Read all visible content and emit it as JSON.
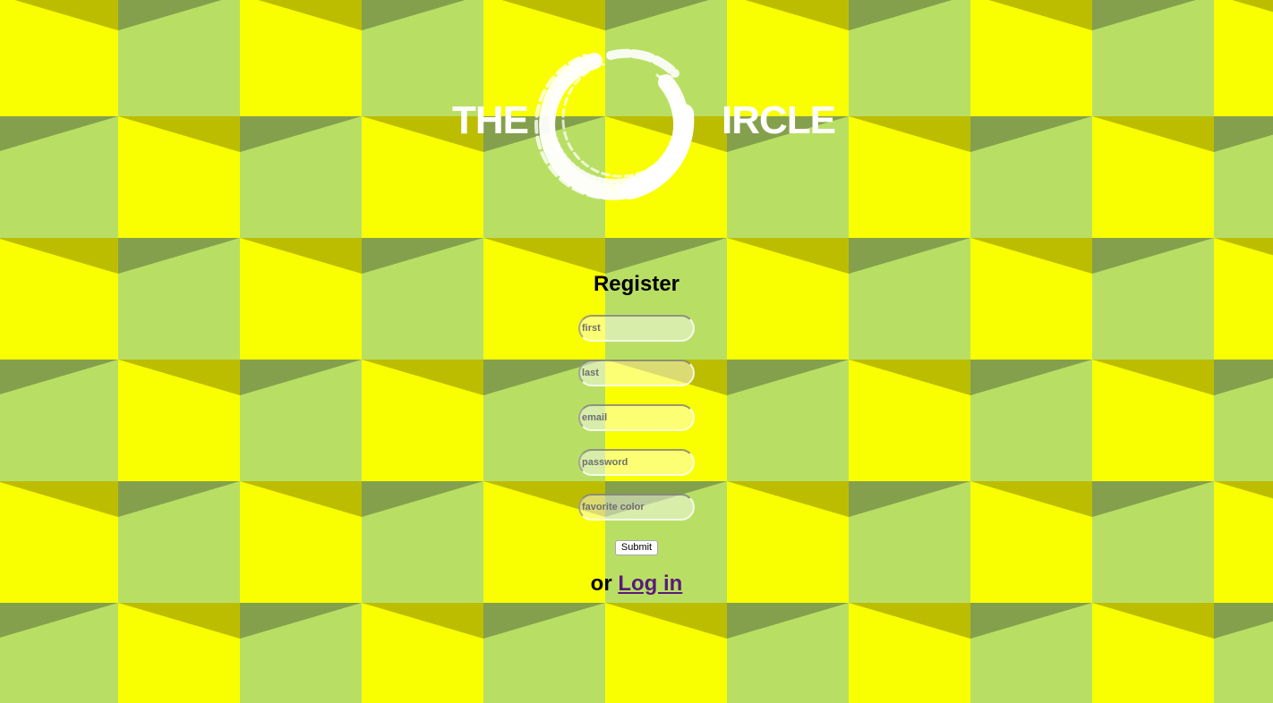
{
  "background": {
    "colors": {
      "yellow": "#f9ff00",
      "green": "#b8df64",
      "shade_dark": "#85a04c",
      "shade_olive": "#bdbd00"
    }
  },
  "logo": {
    "left_text": "THE",
    "right_text": "IRCLE",
    "mark": "brush-circle-icon"
  },
  "form": {
    "title": "Register",
    "fields": [
      {
        "name": "first",
        "placeholder": "first",
        "value": ""
      },
      {
        "name": "last",
        "placeholder": "last",
        "value": ""
      },
      {
        "name": "email",
        "placeholder": "email",
        "value": ""
      },
      {
        "name": "password",
        "placeholder": "password",
        "value": ""
      },
      {
        "name": "favorite-color",
        "placeholder": "favorite color",
        "value": ""
      }
    ],
    "submit_label": "Submit"
  },
  "alt": {
    "prefix": "or",
    "link_label": "Log in"
  }
}
